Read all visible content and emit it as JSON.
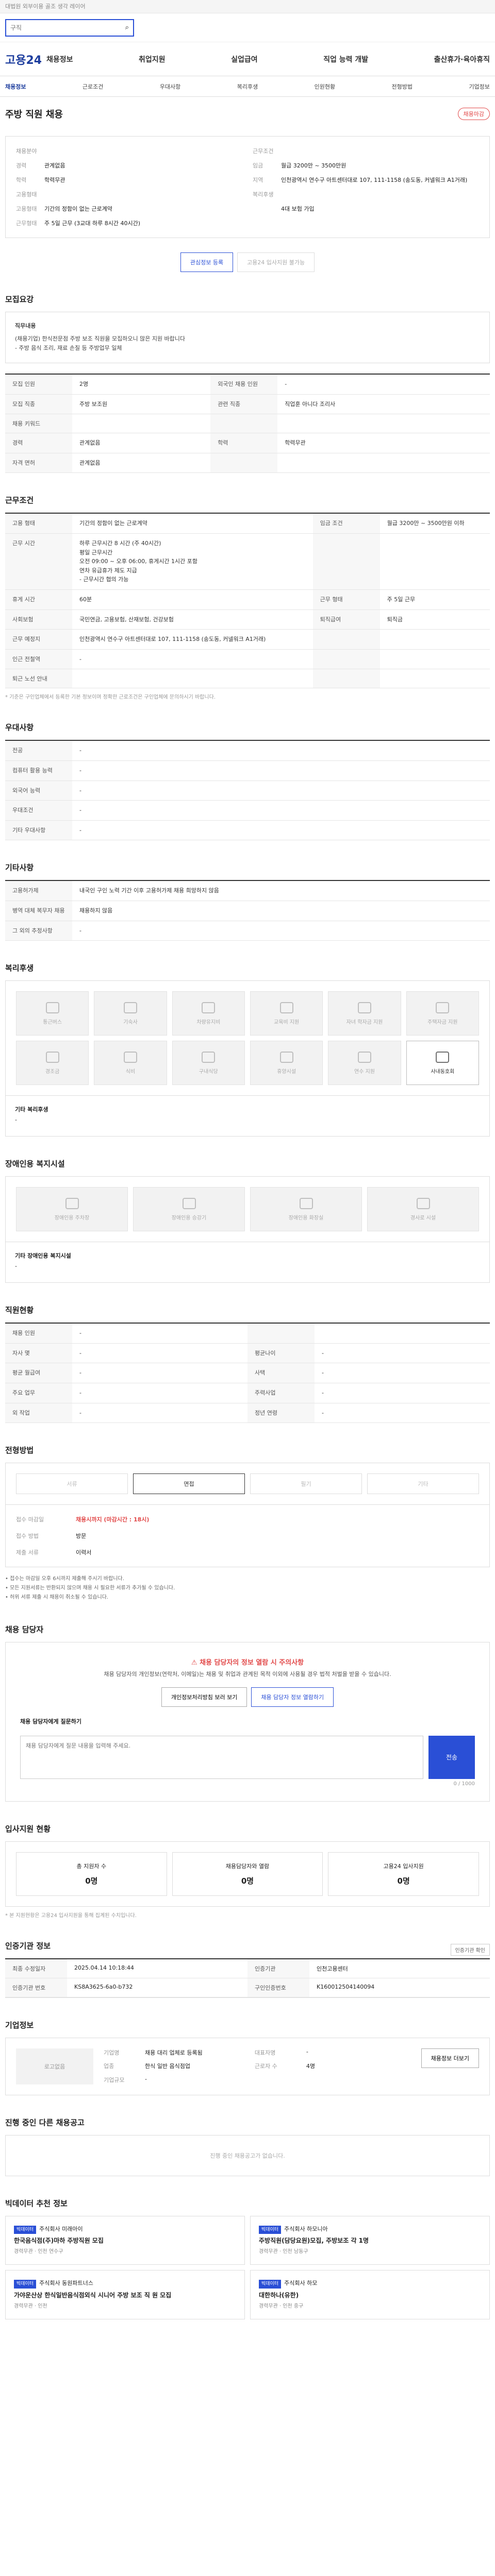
{
  "topbar": {
    "text": "대법원 외부이용 골조 생각 레이어"
  },
  "search": {
    "placeholder": "구직",
    "icon": "search-icon"
  },
  "gnb": {
    "logo": "고용24",
    "menu": [
      "채용정보",
      "취업지원",
      "실업급여",
      "직업 능력 개발",
      "출산휴가·육아휴직"
    ]
  },
  "lnb": [
    "채용정보",
    "근로조건",
    "우대사항",
    "복리후생",
    "인원현황",
    "전형방법",
    "기업정보"
  ],
  "job": {
    "title": "주방 직원 채용",
    "tag": "채용마감",
    "summary": [
      {
        "k": "채용분야",
        "v": ""
      },
      {
        "k": "근무조건",
        "v": ""
      },
      {
        "k": "경력",
        "v": "관계없음"
      },
      {
        "k": "임금",
        "v": "월급 3200만 ~ 3500만원"
      },
      {
        "k": "학력",
        "v": "학력무관"
      },
      {
        "k": "지역",
        "v": "인천광역시 연수구 아트센터대로 107, 111-1158 (송도동, 커넬워크 A1거래)"
      },
      {
        "k": "고용형태",
        "v": ""
      },
      {
        "k": "복리후생",
        "v": ""
      },
      {
        "k": "고용형태",
        "v": "기간의 정함이 없는 근로계약"
      },
      {
        "k": "",
        "v": "4대 보험 가입"
      },
      {
        "k": "근무형태",
        "v": "주 5일 근무 (3교대 하루 8시간 40시간)"
      },
      {
        "k": "",
        "v": ""
      }
    ],
    "buttons": {
      "interest": "관심정보 등록",
      "apply": "고용24 입사지원 불가능"
    }
  },
  "s1": {
    "title": "모집요강",
    "desc_title": "직무내용",
    "desc": [
      "(채용기업) 한식전문점 주방 보조 직원을 모집하오니 많은 지원 바랍니다",
      "- 주방 음식 조리, 재료 손질 등 주방업무 일체"
    ],
    "rows": [
      {
        "k": "모집 인원",
        "v": "2명",
        "k2": "외국인 채용 인원",
        "v2": "-"
      },
      {
        "k": "모집 직종",
        "v": "주방 보조원",
        "k2": "관련 직종",
        "v2": "직업훈 아니다 조리사"
      },
      {
        "k": "채용 키워드",
        "v": "",
        "k2": "",
        "v2": ""
      },
      {
        "k": "경력",
        "v": "관계없음",
        "k2": "학력",
        "v2": "학력무관"
      },
      {
        "k": "자격 면허",
        "v": "관계없음",
        "k2": "",
        "v2": ""
      }
    ]
  },
  "s2": {
    "title": "근무조건",
    "rows": [
      {
        "k": "고용 형태",
        "v": "기간의 정함이 없는 근로계약",
        "k2": "임금 조건",
        "v2": "월급 3200만 ~ 3500만원 이하"
      },
      {
        "k": "근무 시간",
        "v": "하루 근무시간 8 시간 (주 40시간)\n평일 근무시간\n오전 09:00 ~ 오후 06:00, 휴게시간 1시간 포함\n연차 유급휴가 제도 지급\n- 근무시간 협의 가능",
        "k2": "",
        "v2": ""
      },
      {
        "k": "휴게 시간",
        "v": "60분",
        "k2": "근무 형태",
        "v2": "주 5일 근무"
      },
      {
        "k": "사회보험",
        "v": "국민연금, 고용보험, 산재보험, 건강보험",
        "k2": "퇴직급여",
        "v2": "퇴직금"
      },
      {
        "k": "근무 예정지",
        "v": "인천광역시 연수구 아트센터대로 107, 111-1158 (송도동, 커넬워크 A1거래)",
        "k2": "",
        "v2": ""
      },
      {
        "k": "인근 전철역",
        "v": "-",
        "k2": "",
        "v2": ""
      },
      {
        "k": "퇴근 노선 안내",
        "v": "",
        "k2": "",
        "v2": ""
      }
    ],
    "note": "* 기준은 구인업체에서 등록한 기본 정보이며 정확한 근로조건은 구인업체에 문의하시기 바랍니다."
  },
  "s3": {
    "title": "우대사항",
    "rows": [
      {
        "k": "전공",
        "v": "-"
      },
      {
        "k": "컴퓨터 활용 능력",
        "v": "-"
      },
      {
        "k": "외국어 능력",
        "v": "-"
      },
      {
        "k": "우대조건",
        "v": "-"
      },
      {
        "k": "기타 우대사항",
        "v": "-"
      }
    ]
  },
  "s4": {
    "title": "기타사항",
    "rows": [
      {
        "k": "고용허가제",
        "v": "내국인 구인 노력 기간 이후 고용허가제 채용 희망하지 않음"
      },
      {
        "k": "병역 대체 복무자 채용",
        "v": "채용하지 않음"
      },
      {
        "k": "그 외의 추정사항",
        "v": "-"
      }
    ]
  },
  "s5": {
    "title": "복리후생",
    "items": [
      {
        "n": "통근버스",
        "on": false
      },
      {
        "n": "기숙사",
        "on": false
      },
      {
        "n": "차량유지비",
        "on": false
      },
      {
        "n": "교육비 지원",
        "on": false
      },
      {
        "n": "자녀 학자금 지원",
        "on": false
      },
      {
        "n": "주택자금 지원",
        "on": false
      },
      {
        "n": "경조금",
        "on": false
      },
      {
        "n": "식비",
        "on": false
      },
      {
        "n": "구내식당",
        "on": false
      },
      {
        "n": "휴양시설",
        "on": false
      },
      {
        "n": "연수 지원",
        "on": false
      },
      {
        "n": "사내동호회",
        "on": true
      }
    ],
    "etc_title": "기타 복리후생",
    "etc": "-"
  },
  "s6": {
    "title": "장애인용 복지시설",
    "items": [
      "장애인용 주차장",
      "장애인용 승강기",
      "장애인용 화장실",
      "경사로 시설"
    ],
    "etc_title": "기타 장애인용 복지시설",
    "etc": "-"
  },
  "s7": {
    "title": "직원현황",
    "rows": [
      {
        "k": "채용 인원",
        "v": "-",
        "k2": "",
        "v2": ""
      },
      {
        "k": "자사 몇",
        "v": "-",
        "k2": "평균나이",
        "v2": "-"
      },
      {
        "k": "평균 월급여",
        "v": "-",
        "k2": "사택",
        "v2": "-"
      },
      {
        "k": "주요 업무",
        "v": "-",
        "k2": "주력사업",
        "v2": "-"
      },
      {
        "k": "외 작업",
        "v": "-",
        "k2": "정년 연령",
        "v2": "-"
      }
    ]
  },
  "s8": {
    "title": "전형방법",
    "steps": [
      {
        "n": "서류",
        "on": false
      },
      {
        "n": "면접",
        "on": true
      },
      {
        "n": "필기",
        "on": false
      },
      {
        "n": "기타",
        "on": false
      }
    ],
    "apply": [
      {
        "k": "접수 마감일",
        "v": "채용시까지 (마감시간 : 18시)"
      },
      {
        "k": "접수 방법",
        "v": "방문"
      },
      {
        "k": "제출 서류",
        "v": "이력서"
      }
    ],
    "bullets": [
      "• 접수는 마감일 오후 6시까지 제출해 주시기 바랍니다.",
      "• 모든 지원서류는 반환되지 않으며 채용 시 필요한 서류가 추가될 수 있습니다.",
      "• 허위 서류 제출 시 채용이 취소될 수 있습니다."
    ]
  },
  "s9": {
    "title": "채용 담당자",
    "alert": "채용 담당자의 정보 열람 시 주의사항",
    "p1": "채용 담당자의 개인정보(연락처, 이메일)는 채용 및 취업과 관계된 목적 이외에 사용될 경우 법적 처벌을 받을 수 있습니다.",
    "btn1": "개인정보처리방침 보러 보기",
    "btn2": "채용 담당자 정보 열람하기",
    "ta_label": "채용 담당자에게 질문하기",
    "placeholder": "채용 담당자에게 질문 내용을 입력해 주세요.",
    "send": "전송",
    "counter": "0 / 1000"
  },
  "s10": {
    "title": "입사지원 현황",
    "stats": [
      {
        "k": "총 지원자 수",
        "v": "0명"
      },
      {
        "k": "채용담당자와 열람",
        "v": "0명"
      },
      {
        "k": "고용24 입사지원",
        "v": "0명"
      }
    ],
    "note": "* 본 지원현황은 고용24 입사지원을 통해 집계된 수치입니다."
  },
  "s11": {
    "title": "인증기관 정보",
    "rows": [
      {
        "k": "최종 수정일자",
        "v": "2025.04.14 10:18:44",
        "k2": "인증기관",
        "v2": "인천고용센터"
      },
      {
        "k": "인증기관 번호",
        "v": "KS8A3625-6a0-b732",
        "k2": "구인인증번호",
        "v2": "K160012504140094"
      }
    ],
    "link": "인증기관 확인"
  },
  "s12": {
    "title": "기업정보",
    "logo": "로고없음",
    "rows": [
      {
        "k": "기업명",
        "v": "채용 대리 업체로 등록됨"
      },
      {
        "k": "업종",
        "v": "한식 일반 음식점업"
      },
      {
        "k": "기업규모",
        "v": "-"
      }
    ],
    "rows2": [
      {
        "k": "대표자명",
        "v": "-"
      },
      {
        "k": "근로자 수",
        "v": "4명"
      }
    ],
    "btn": "채용정보 더보기"
  },
  "s13": {
    "title": "진행 중인 다른 채용공고",
    "empty": "진행 중인 채용공고가 없습니다."
  },
  "s14": {
    "title": "빅데이터 추천 정보",
    "recs": [
      {
        "badge": "빅데이터",
        "co": "주식회사 미래아이",
        "t": "한국음식점(주)마하 주방직원 모집",
        "meta": "경력무관 · 인천 연수구"
      },
      {
        "badge": "빅데이터",
        "co": "주식회사 하모니아",
        "t": "주방직원(담당요원)모집, 주방보조 각 1명",
        "meta": "경력무관 · 인천 남동구"
      },
      {
        "badge": "빅데이터",
        "co": "주식회사 동원파트너스",
        "t": "가야운산상 한식일반음식점외식 시니어 주방 보조 직 원 모집",
        "meta": "경력무관 · 인천"
      },
      {
        "badge": "빅데이터",
        "co": "주식회사 하모",
        "t": "대한하나(유한)",
        "meta": "경력무관 · 인천 중구"
      }
    ]
  }
}
